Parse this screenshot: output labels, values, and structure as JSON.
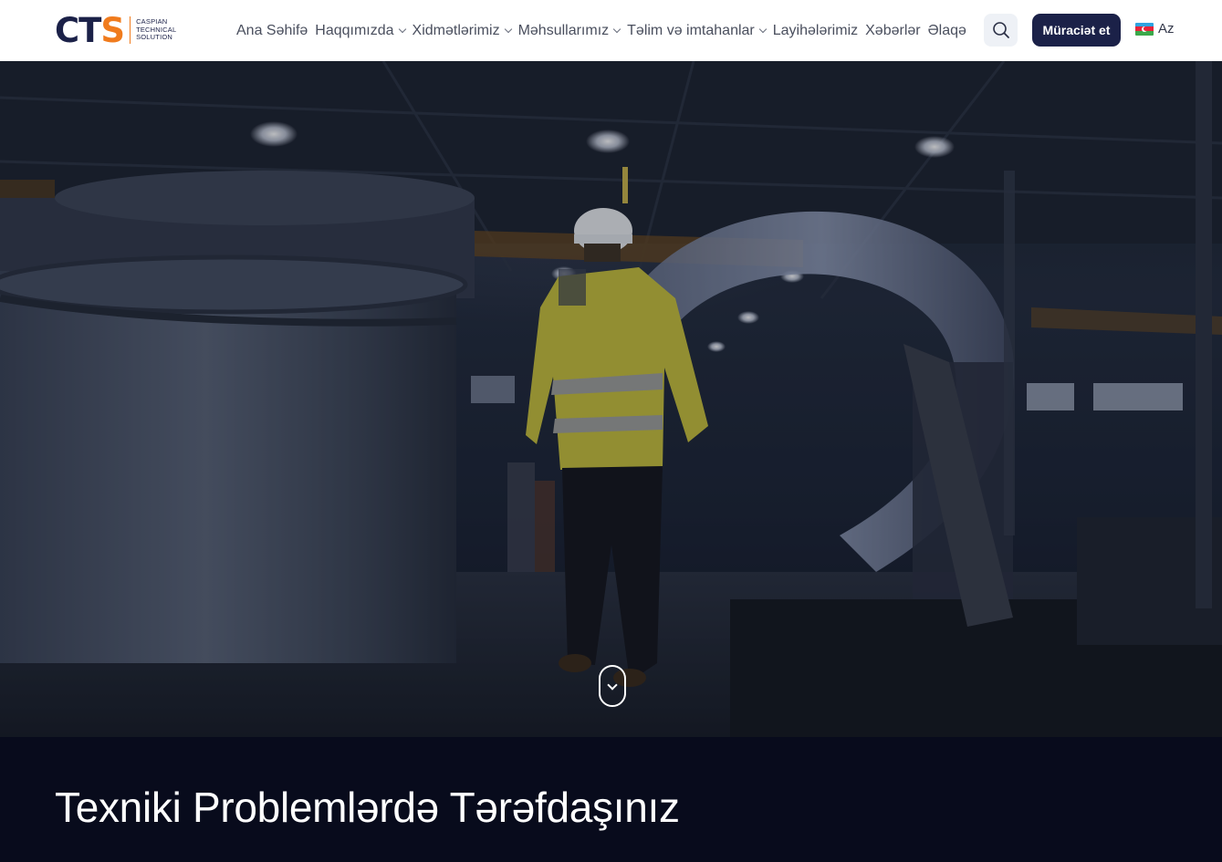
{
  "brand": {
    "logo_text_main": "CT",
    "logo_text_accent": "S",
    "logo_sub_lines": [
      "CASPIAN",
      "TECHNICAL",
      "SOLUTION"
    ],
    "primary_color": "#1b2148",
    "accent_color": "#f07b1d"
  },
  "nav": {
    "items": [
      {
        "label": "Ana Səhifə",
        "has_dropdown": false
      },
      {
        "label": "Haqqımızda",
        "has_dropdown": true
      },
      {
        "label": "Xidmətlərimiz",
        "has_dropdown": true
      },
      {
        "label": "Məhsullarımız",
        "has_dropdown": true
      },
      {
        "label": "Təlim və imtahanlar",
        "has_dropdown": true
      },
      {
        "label": "Layihələrimiz",
        "has_dropdown": false
      },
      {
        "label": "Xəbərlər",
        "has_dropdown": false
      },
      {
        "label": "Əlaqə",
        "has_dropdown": false
      }
    ]
  },
  "header_actions": {
    "search_icon": "search-icon",
    "cta_label": "Müraciət et",
    "language_label": "Az",
    "language_flag": "azerbaijan-flag-icon"
  },
  "hero": {
    "scroll_icon": "scroll-down-icon"
  },
  "band": {
    "heading": "Texniki Problemlərdə Tərəfdaşınız"
  }
}
